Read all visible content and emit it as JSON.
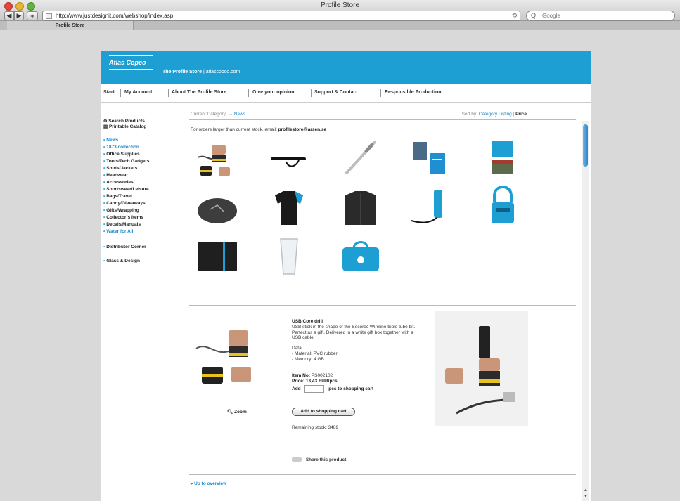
{
  "window": {
    "title": "Profile Store"
  },
  "browser": {
    "url": "http://www.justdesignit.com/webshop/index.asp",
    "search_placeholder": "Google",
    "tab_label": "Profile Store",
    "back_glyph": "◀",
    "forward_glyph": "▶",
    "new_tab_glyph": "+",
    "reload_glyph": "⟲",
    "search_glyph": "Q"
  },
  "brand": {
    "logo_text": "Atlas Copco",
    "store_title": "The Profile Store",
    "store_subtitle": "| atlascopco.com"
  },
  "topnav": [
    "Start",
    "My Account",
    "About The Profile Store",
    "Give your opinion",
    "Support & Contact",
    "Responsible Production"
  ],
  "sidebar": {
    "tools": [
      "Search Products",
      "Printable Catalog"
    ],
    "categories": [
      "News",
      "1873 collection",
      "Office Supplies",
      "Tools/Tech Gadgets",
      "Shirts/Jackets",
      "Headwear",
      "Accessories",
      "Sportswear/Leisure",
      "Bags/Travel",
      "Candy/Giveaways",
      "Gifts/Wrapping",
      "Collector´s Items",
      "Decals/Manuals",
      "Water for All"
    ],
    "extra": [
      "Distributor Corner",
      "Glass & Design"
    ]
  },
  "breadcrumb": {
    "label": "Current Category:",
    "arrow": "→",
    "current": "News"
  },
  "sort": {
    "label": "Sort by:",
    "option_a": "Category Listing",
    "sep": "|",
    "option_b": "Price"
  },
  "notice": {
    "text": "For orders larger than current stock, email:",
    "email": "profilestore@arsen.se"
  },
  "products": [
    {
      "name": "usb-core-drill",
      "icon": "usb-drill-icon"
    },
    {
      "name": "lanyard",
      "icon": "lanyard-icon"
    },
    {
      "name": "pen",
      "icon": "pen-icon"
    },
    {
      "name": "book-box",
      "icon": "book-icon"
    },
    {
      "name": "booklet",
      "icon": "booklet-icon"
    },
    {
      "name": "stone",
      "icon": "stone-icon"
    },
    {
      "name": "polo-shirt",
      "icon": "shirt-icon"
    },
    {
      "name": "sweater",
      "icon": "sweater-icon"
    },
    {
      "name": "flashlight",
      "icon": "flashlight-icon"
    },
    {
      "name": "padlock",
      "icon": "padlock-icon"
    },
    {
      "name": "wallet",
      "icon": "wallet-icon"
    },
    {
      "name": "glass",
      "icon": "glass-icon"
    },
    {
      "name": "bag",
      "icon": "bag-icon"
    }
  ],
  "detail": {
    "title": "USB Core drill",
    "description": "USB stick in the shape of the Secoroc Wireline triple tube bit. Perfect as a gift. Delivered in a white gift box together with a USB cable.",
    "data_heading": "Data:",
    "data_lines": [
      "- Material: PVC rubber",
      "- Memory: 4 GB"
    ],
    "item_label": "Item No:",
    "item_no": "PS002102",
    "price_label": "Price:",
    "price": "13,43 EUR/pcs",
    "add_prefix": "Add",
    "add_suffix": "pcs  to shopping cart",
    "cart_button": "Add to shopping cart",
    "remaining": "Remaining stock: 3489",
    "share": "Share this product",
    "zoom": "Zoom"
  },
  "overview_link": "Up to overview",
  "colors": {
    "brand": "#1e9fd3",
    "link": "#1e88c8"
  }
}
